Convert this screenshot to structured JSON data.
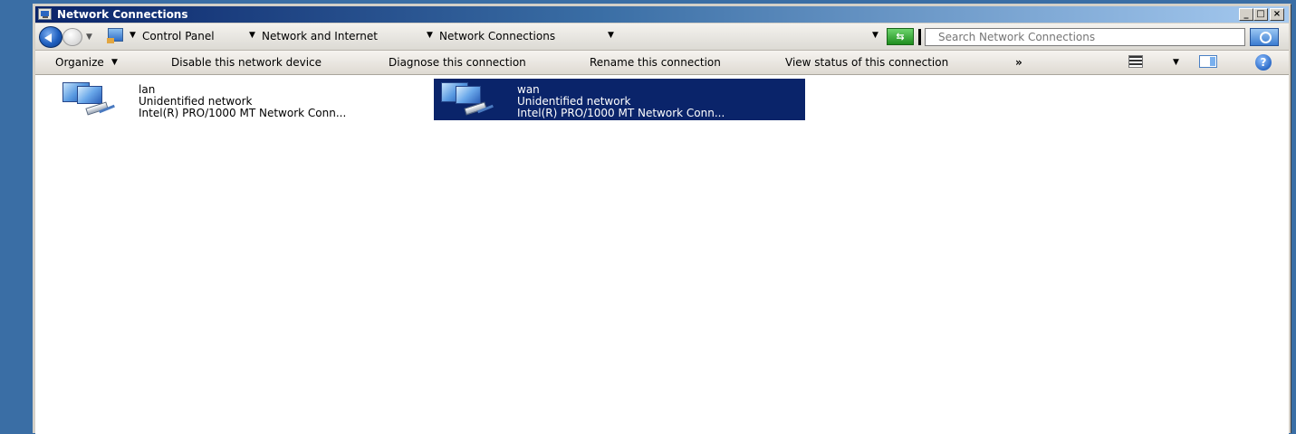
{
  "window": {
    "title": "Network Connections"
  },
  "address_bar": {
    "breadcrumbs": [
      "Control Panel",
      "Network and Internet",
      "Network Connections"
    ],
    "search_placeholder": "Search Network Connections"
  },
  "toolbar": {
    "organize": "Organize",
    "disable": "Disable this network device",
    "diagnose": "Diagnose this connection",
    "rename": "Rename this connection",
    "view_status": "View status of this connection",
    "more": "»",
    "help": "?"
  },
  "connections": [
    {
      "name": "lan",
      "status": "Unidentified network",
      "adapter": "Intel(R) PRO/1000 MT Network Conn...",
      "selected": false
    },
    {
      "name": "wan",
      "status": "Unidentified network",
      "adapter": "Intel(R) PRO/1000 MT Network Conn...",
      "selected": true
    }
  ],
  "colors": {
    "desktop": "#3a6ea5",
    "title_start": "#0a246a",
    "selection": "#0a246a"
  }
}
